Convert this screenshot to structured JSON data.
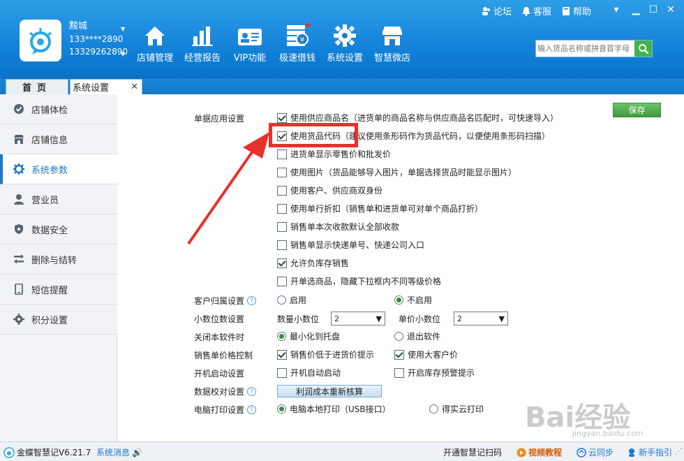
{
  "header": {
    "user_name": "黢城",
    "phone1": "133****2890",
    "phone2": "13329262890",
    "nav": [
      {
        "label": "店铺管理",
        "icon": "home-icon"
      },
      {
        "label": "经营报告",
        "icon": "bar-chart-icon"
      },
      {
        "label": "VIP功能",
        "icon": "vip-card-icon"
      },
      {
        "label": "极速借钱",
        "icon": "money-icon"
      },
      {
        "label": "系统设置",
        "icon": "gear-icon"
      },
      {
        "label": "智慧微店",
        "icon": "shop-icon"
      }
    ],
    "links": {
      "forum": "论坛",
      "service": "客服",
      "help": "帮助"
    },
    "search_placeholder": "输入货品名称或拼音首字母"
  },
  "tabs": {
    "home": "首页",
    "settings": "系统设置"
  },
  "sidebar": {
    "items": [
      {
        "label": "店铺体检",
        "icon": "check-circle-icon"
      },
      {
        "label": "店铺信息",
        "icon": "store-icon"
      },
      {
        "label": "系统参数",
        "icon": "gear-icon"
      },
      {
        "label": "营业员",
        "icon": "person-icon"
      },
      {
        "label": "数据安全",
        "icon": "shield-icon"
      },
      {
        "label": "删除与结转",
        "icon": "transfer-icon"
      },
      {
        "label": "短信提醒",
        "icon": "phone-icon"
      },
      {
        "label": "积分设置",
        "icon": "gear-small-icon"
      }
    ],
    "active_index": 2
  },
  "main": {
    "save": "保存",
    "doc_settings_label": "单据应用设置",
    "doc_options": [
      {
        "label": "使用供应商品名（进货单的商品名称与供应商品名匹配时，可快速导入）",
        "checked": true
      },
      {
        "label": "使用货品代码（建议使用条形码作为货品代码，以便使用条形码扫描）",
        "checked": true
      },
      {
        "label": "进货单显示零售价和批发价",
        "checked": false
      },
      {
        "label": "使用图片（货品能够导入图片，单据选择货品时能显示图片）",
        "checked": false
      },
      {
        "label": "使用客户、供应商双身份",
        "checked": false
      },
      {
        "label": "使用单行折扣（销售单和进货单可对单个商品打折）",
        "checked": false
      },
      {
        "label": "销售单本次收款默认全部收款",
        "checked": false
      },
      {
        "label": "销售单显示快递单号、快递公司入口",
        "checked": false
      },
      {
        "label": "允许负库存销售",
        "checked": true
      },
      {
        "label": "开单选商品，隐藏下拉框内不同等级价格",
        "checked": false
      }
    ],
    "customer_label": "客户归属设置",
    "customer_enable": "启用",
    "customer_disable": "不启用",
    "decimal_label": "小数位数设置",
    "qty_decimal_label": "数量小数位",
    "qty_decimal_value": "2",
    "price_decimal_label": "单价小数位",
    "price_decimal_value": "2",
    "close_label": "关闭本软件时",
    "close_minimize": "最小化到托盘",
    "close_exit": "退出软件",
    "price_ctrl_label": "销售单价格控制",
    "price_low_tip": "销售价低于进货价提示",
    "use_big_customer": "使用大客户价",
    "startup_label": "开机启动设置",
    "auto_start": "开机自动启动",
    "stock_warn": "开启库存预警提示",
    "verify_label": "数据校对设置",
    "recalc_button": "利润成本重新核算",
    "print_label": "电脑打印设置",
    "print_local": "电脑本地打印（USB接口）",
    "print_cloud": "得实云打印"
  },
  "status": {
    "app": "金蝶智慧记V6.21.7",
    "msg": "系统消息",
    "promo": "开通智慧记扫码",
    "video": "视频教程",
    "sync": "云同步",
    "guide": "新手指引"
  },
  "watermark": {
    "text": "Bai经验",
    "sub": "jingyan.baidu.com"
  }
}
